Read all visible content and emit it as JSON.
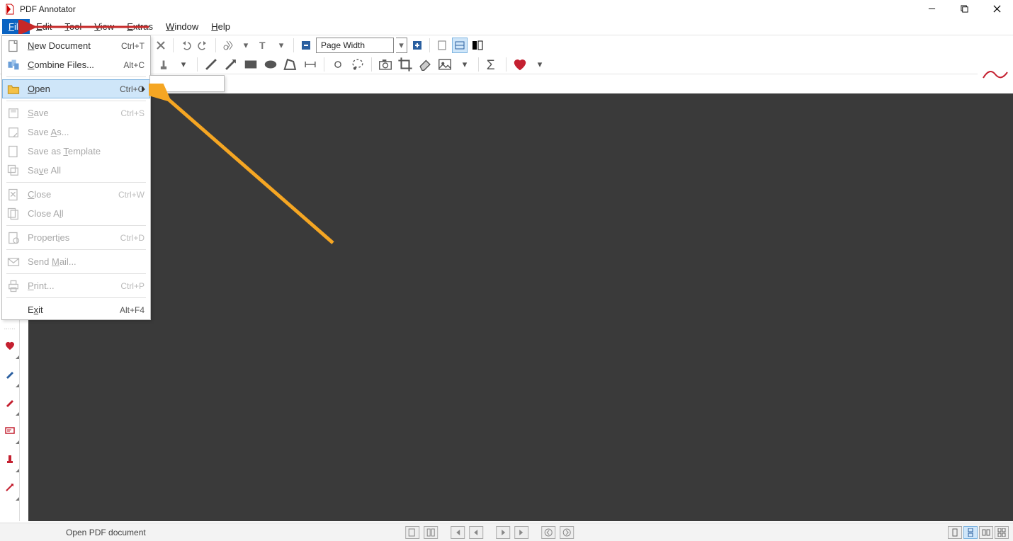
{
  "app": {
    "title": "PDF Annotator"
  },
  "menubar": {
    "items": [
      {
        "label": "File",
        "u": "F",
        "rest": "ile"
      },
      {
        "label": "Edit",
        "u": "E",
        "rest": "dit"
      },
      {
        "label": "Tool",
        "u": "T",
        "rest": "ool"
      },
      {
        "label": "View",
        "u": "V",
        "rest": "iew"
      },
      {
        "label": "Extras",
        "u": "E",
        "rest": "xtras"
      },
      {
        "label": "Window",
        "u": "W",
        "rest": "indow"
      },
      {
        "label": "Help",
        "u": "H",
        "rest": "elp"
      }
    ]
  },
  "file_menu": {
    "groups": [
      [
        {
          "icon": "new-doc",
          "label": "New Document",
          "u": "N",
          "rest": "ew Document",
          "shortcut": "Ctrl+T",
          "enabled": true
        },
        {
          "icon": "combine",
          "label": "Combine Files...",
          "u": "C",
          "rest": "ombine Files...",
          "shortcut": "Alt+C",
          "enabled": true
        }
      ],
      [
        {
          "icon": "folder",
          "label": "Open",
          "u": "O",
          "rest": "pen",
          "shortcut": "Ctrl+O",
          "enabled": true,
          "submenu": true,
          "hover": true
        }
      ],
      [
        {
          "icon": "save",
          "label": "Save",
          "u": "S",
          "rest": "ave",
          "shortcut": "Ctrl+S",
          "enabled": false
        },
        {
          "icon": "save-as",
          "label": "Save As...",
          "u": "A",
          "rest": "s...",
          "pre": "Save ",
          "shortcut": "",
          "enabled": false
        },
        {
          "icon": "template",
          "label": "Save as Template",
          "u": "T",
          "rest": "emplate",
          "pre": "Save as ",
          "shortcut": "",
          "enabled": false
        },
        {
          "icon": "save-all",
          "label": "Save All",
          "u": "v",
          "rest": "e All",
          "pre": "Sa",
          "shortcut": "",
          "enabled": false
        }
      ],
      [
        {
          "icon": "close",
          "label": "Close",
          "u": "C",
          "rest": "lose",
          "shortcut": "Ctrl+W",
          "enabled": false
        },
        {
          "icon": "close-all",
          "label": "Close All",
          "u": "l",
          "rest": "l",
          "pre": "Close A",
          "shortcut": "",
          "enabled": false
        }
      ],
      [
        {
          "icon": "props",
          "label": "Properties",
          "u": "i",
          "rest": "es",
          "pre": "Propert",
          "shortcut": "Ctrl+D",
          "enabled": false
        }
      ],
      [
        {
          "icon": "mail",
          "label": "Send Mail...",
          "u": "M",
          "rest": "ail...",
          "pre": "Send ",
          "shortcut": "",
          "enabled": false
        }
      ],
      [
        {
          "icon": "print",
          "label": "Print...",
          "u": "P",
          "rest": "rint...",
          "shortcut": "Ctrl+P",
          "enabled": false
        }
      ],
      [
        {
          "icon": "",
          "label": "Exit",
          "u": "x",
          "rest": "it",
          "pre": "E",
          "shortcut": "Alt+F4",
          "enabled": true
        }
      ]
    ]
  },
  "toolbar": {
    "zoom_label": "Page Width"
  },
  "statusbar": {
    "text": "Open PDF document"
  }
}
